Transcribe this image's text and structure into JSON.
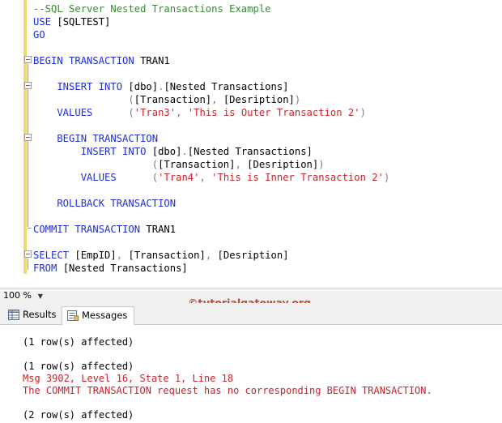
{
  "editor": {
    "lines": [
      [
        {
          "t": "--SQL Server Nested Transactions Example",
          "c": "cmt"
        }
      ],
      [
        {
          "t": "USE ",
          "c": "kw"
        },
        {
          "t": "[SQLTEST]",
          "c": "plain"
        }
      ],
      [
        {
          "t": "GO",
          "c": "kw"
        }
      ],
      [],
      [
        {
          "t": "BEGIN TRANSACTION ",
          "c": "kw"
        },
        {
          "t": "TRAN1",
          "c": "plain"
        }
      ],
      [],
      [
        {
          "t": "    INSERT INTO ",
          "c": "kw"
        },
        {
          "t": "[dbo]",
          "c": "plain"
        },
        {
          "t": ".",
          "c": "gray"
        },
        {
          "t": "[Nested Transactions]",
          "c": "plain"
        }
      ],
      [
        {
          "t": "                (",
          "c": "gray"
        },
        {
          "t": "[Transaction]",
          "c": "plain"
        },
        {
          "t": ", ",
          "c": "gray"
        },
        {
          "t": "[Desription]",
          "c": "plain"
        },
        {
          "t": ")",
          "c": "gray"
        }
      ],
      [
        {
          "t": "    VALUES      ",
          "c": "kw"
        },
        {
          "t": "(",
          "c": "gray"
        },
        {
          "t": "'Tran3'",
          "c": "str"
        },
        {
          "t": ", ",
          "c": "gray"
        },
        {
          "t": "'This is Outer Transaction 2'",
          "c": "str"
        },
        {
          "t": ")",
          "c": "gray"
        }
      ],
      [],
      [
        {
          "t": "    BEGIN TRANSACTION",
          "c": "kw"
        }
      ],
      [
        {
          "t": "        INSERT INTO ",
          "c": "kw"
        },
        {
          "t": "[dbo]",
          "c": "plain"
        },
        {
          "t": ".",
          "c": "gray"
        },
        {
          "t": "[Nested Transactions]",
          "c": "plain"
        }
      ],
      [
        {
          "t": "                    (",
          "c": "gray"
        },
        {
          "t": "[Transaction]",
          "c": "plain"
        },
        {
          "t": ", ",
          "c": "gray"
        },
        {
          "t": "[Desription]",
          "c": "plain"
        },
        {
          "t": ")",
          "c": "gray"
        }
      ],
      [
        {
          "t": "        VALUES      ",
          "c": "kw"
        },
        {
          "t": "(",
          "c": "gray"
        },
        {
          "t": "'Tran4'",
          "c": "str"
        },
        {
          "t": ", ",
          "c": "gray"
        },
        {
          "t": "'This is Inner Transaction 2'",
          "c": "str"
        },
        {
          "t": ")",
          "c": "gray"
        }
      ],
      [],
      [
        {
          "t": "    ROLLBACK TRANSACTION",
          "c": "kw"
        }
      ],
      [],
      [
        {
          "t": "COMMIT TRANSACTION ",
          "c": "kw"
        },
        {
          "t": "TRAN1",
          "c": "plain"
        }
      ],
      [],
      [
        {
          "t": "SELECT ",
          "c": "kw"
        },
        {
          "t": "[EmpID]",
          "c": "plain"
        },
        {
          "t": ", ",
          "c": "gray"
        },
        {
          "t": "[Transaction]",
          "c": "plain"
        },
        {
          "t": ", ",
          "c": "gray"
        },
        {
          "t": "[Desription]",
          "c": "plain"
        }
      ],
      [
        {
          "t": "FROM ",
          "c": "kw"
        },
        {
          "t": "[Nested Transactions]",
          "c": "plain"
        }
      ]
    ]
  },
  "statusbar": {
    "zoom": "100 %",
    "watermark": "©tutorialgateway.org"
  },
  "tabs": {
    "results_label": "Results",
    "messages_label": "Messages"
  },
  "messages": [
    {
      "text": "(1 row(s) affected)",
      "type": "normal"
    },
    {
      "text": "",
      "type": "normal"
    },
    {
      "text": "(1 row(s) affected)",
      "type": "normal"
    },
    {
      "text": "Msg 3902, Level 16, State 1, Line 18",
      "type": "err"
    },
    {
      "text": "The COMMIT TRANSACTION request has no corresponding BEGIN TRANSACTION.",
      "type": "err"
    },
    {
      "text": "",
      "type": "normal"
    },
    {
      "text": "(2 row(s) affected)",
      "type": "normal"
    }
  ],
  "colors": {
    "keyword": "#1f2fd8",
    "string": "#c8242a",
    "error": "#c8242a",
    "change_bar": "#f3da6e",
    "watermark": "#c54a2e"
  }
}
